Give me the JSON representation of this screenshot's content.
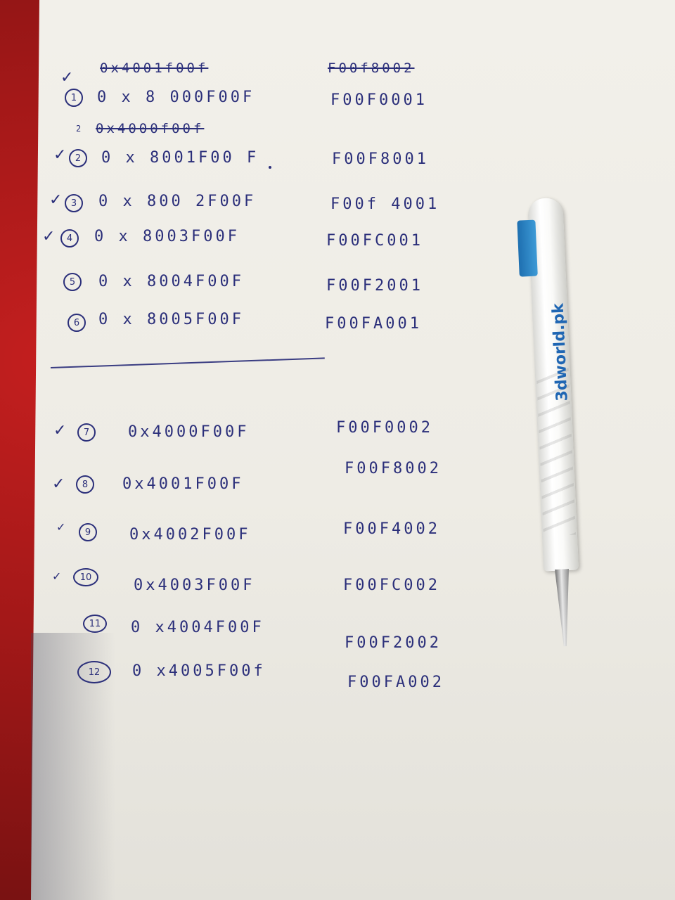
{
  "crossed_out": [
    {
      "address": "0x4001f00f",
      "value": "F00f8002"
    },
    {
      "address": "0x4000f00f",
      "prefix": "2"
    }
  ],
  "top_section": [
    {
      "index": "1",
      "address": "0 x 8 000F00F",
      "value": "F00F0001",
      "checked": false
    },
    {
      "index": "2",
      "address": "0 x 8001F00 F",
      "value": "F00F8001",
      "checked": true
    },
    {
      "index": "3",
      "address": "0 x 800 2F00F",
      "value": "F00f 4001",
      "checked": true
    },
    {
      "index": "4",
      "address": "0 x 8003F00F",
      "value": "F00FC001",
      "checked": true
    },
    {
      "index": "5",
      "address": "0 x 8004F00F",
      "value": "F00F2001",
      "checked": false
    },
    {
      "index": "6",
      "address": "0 x 8005F00F",
      "value": "F00FA001",
      "checked": false
    }
  ],
  "bottom_section": [
    {
      "index": "7",
      "address": "0x4000F00F",
      "value": "F00F0002",
      "checked": true
    },
    {
      "index": "8",
      "address": "0x4001F00F",
      "value": "F00F8002",
      "checked": true
    },
    {
      "index": "9",
      "address": "0x4002F00F",
      "value": "F00F4002",
      "checked": true
    },
    {
      "index": "10",
      "address": "0x4003F00F",
      "value": "F00FC002",
      "checked": true
    },
    {
      "index": "11",
      "address": "0 x4004F00F",
      "value": "F00F2002",
      "checked": false
    },
    {
      "index": "12",
      "address": "0 x4005F00f",
      "value": "F00FA002",
      "checked": false
    }
  ],
  "pen": {
    "brand": "3dworld.pk"
  },
  "colors": {
    "ink": "#2b2f7a",
    "paper": "#f0eee8",
    "table": "#b01a1a",
    "pen_accent": "#1f66b3"
  }
}
